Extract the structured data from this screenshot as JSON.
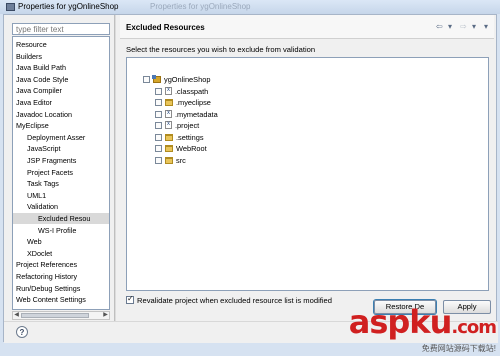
{
  "window": {
    "title": "Properties for ygOnlineShop",
    "ghost_title": "Properties for ygOnlineShop"
  },
  "filter": {
    "placeholder": "type filter text"
  },
  "nav": {
    "items": [
      {
        "label": "Resource",
        "indent": 0
      },
      {
        "label": "Builders",
        "indent": 0
      },
      {
        "label": "Java Build Path",
        "indent": 0
      },
      {
        "label": "Java Code Style",
        "indent": 0
      },
      {
        "label": "Java Compiler",
        "indent": 0
      },
      {
        "label": "Java Editor",
        "indent": 0
      },
      {
        "label": "Javadoc Location",
        "indent": 0
      },
      {
        "label": "MyEclipse",
        "indent": 0
      },
      {
        "label": "Deployment Asser",
        "indent": 1
      },
      {
        "label": "JavaScript",
        "indent": 1
      },
      {
        "label": "JSP Fragments",
        "indent": 1
      },
      {
        "label": "Project Facets",
        "indent": 1
      },
      {
        "label": "Task Tags",
        "indent": 1
      },
      {
        "label": "UML1",
        "indent": 1
      },
      {
        "label": "Validation",
        "indent": 1
      },
      {
        "label": "Excluded Resou",
        "indent": 2,
        "selected": true
      },
      {
        "label": "WS-I Profile",
        "indent": 2
      },
      {
        "label": "Web",
        "indent": 1
      },
      {
        "label": "XDoclet",
        "indent": 1
      },
      {
        "label": "Project References",
        "indent": 0
      },
      {
        "label": "Refactoring History",
        "indent": 0
      },
      {
        "label": "Run/Debug Settings",
        "indent": 0
      },
      {
        "label": "Web Content Settings",
        "indent": 0
      }
    ]
  },
  "panel": {
    "title": "Excluded Resources",
    "back_icon": "⇦",
    "forward_icon": "⇨",
    "menu_icon": "▾",
    "instruction": "Select the resources you wish to exclude from validation"
  },
  "tree": {
    "nodes": [
      {
        "label": "ygOnlineShop",
        "icon": "project",
        "depth": 0
      },
      {
        "label": ".classpath",
        "icon": "file",
        "depth": 1
      },
      {
        "label": ".myeclipse",
        "icon": "folder",
        "depth": 1
      },
      {
        "label": ".mymetadata",
        "icon": "file",
        "depth": 1
      },
      {
        "label": ".project",
        "icon": "file",
        "depth": 1
      },
      {
        "label": ".settings",
        "icon": "folder",
        "depth": 1
      },
      {
        "label": "WebRoot",
        "icon": "folder",
        "depth": 1
      },
      {
        "label": "src",
        "icon": "folder",
        "depth": 1
      }
    ]
  },
  "revalidate": {
    "label": "Revalidate project when excluded resource list is modified",
    "checked": true
  },
  "buttons": {
    "restore": "Restore De",
    "apply": "Apply"
  },
  "help": {
    "glyph": "?"
  },
  "watermark": {
    "brand": "aspku",
    "domain": ".com",
    "subtitle": "免费网站源码下载站!"
  }
}
